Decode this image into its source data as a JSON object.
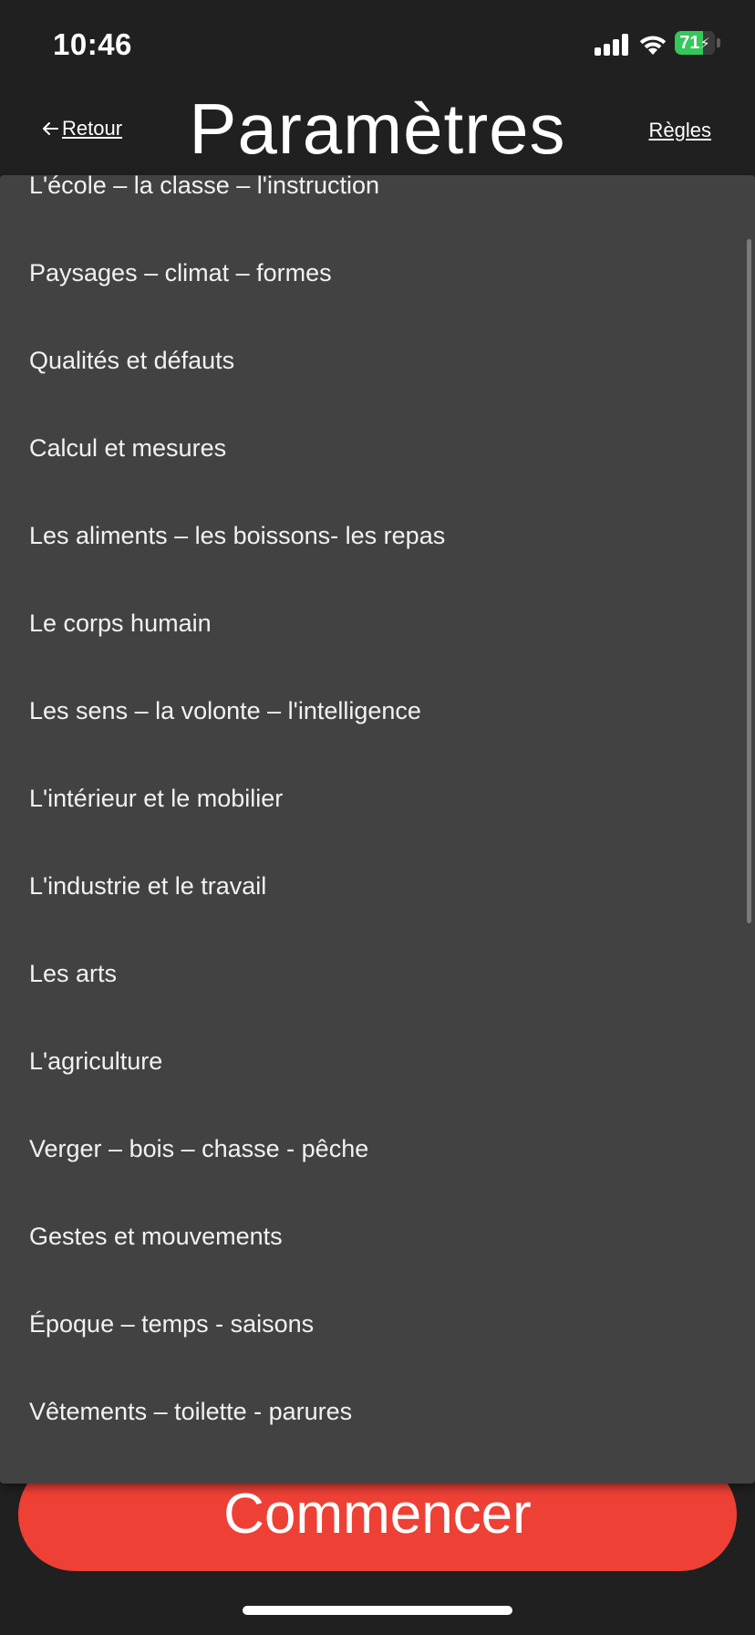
{
  "status_bar": {
    "time": "10:46",
    "battery_level": "71",
    "battery_charging": true,
    "icons": [
      "signal-icon",
      "wifi-icon",
      "battery-icon"
    ]
  },
  "header": {
    "back_label": "Retour",
    "back_icon": "arrow-left-icon",
    "title": "Paramètres",
    "rules_label": "Règles"
  },
  "dropdown": {
    "items": [
      "L'école – la classe – l'instruction",
      "Paysages – climat – formes",
      "Qualités et défauts",
      "Calcul et mesures",
      "Les aliments – les boissons- les repas",
      "Le corps humain",
      "Les sens – la volonte – l'intelligence",
      "L'intérieur et le mobilier",
      "L'industrie et le travail",
      "Les arts",
      "L'agriculture",
      "Verger – bois – chasse - pêche",
      "Gestes et mouvements",
      "Époque – temps - saisons",
      "Vêtements – toilette - parures"
    ]
  },
  "start_button": {
    "label": "Commencer"
  },
  "colors": {
    "background": "#202020",
    "dropdown_bg": "#424242",
    "accent": "#ee4035",
    "battery": "#34c759"
  }
}
